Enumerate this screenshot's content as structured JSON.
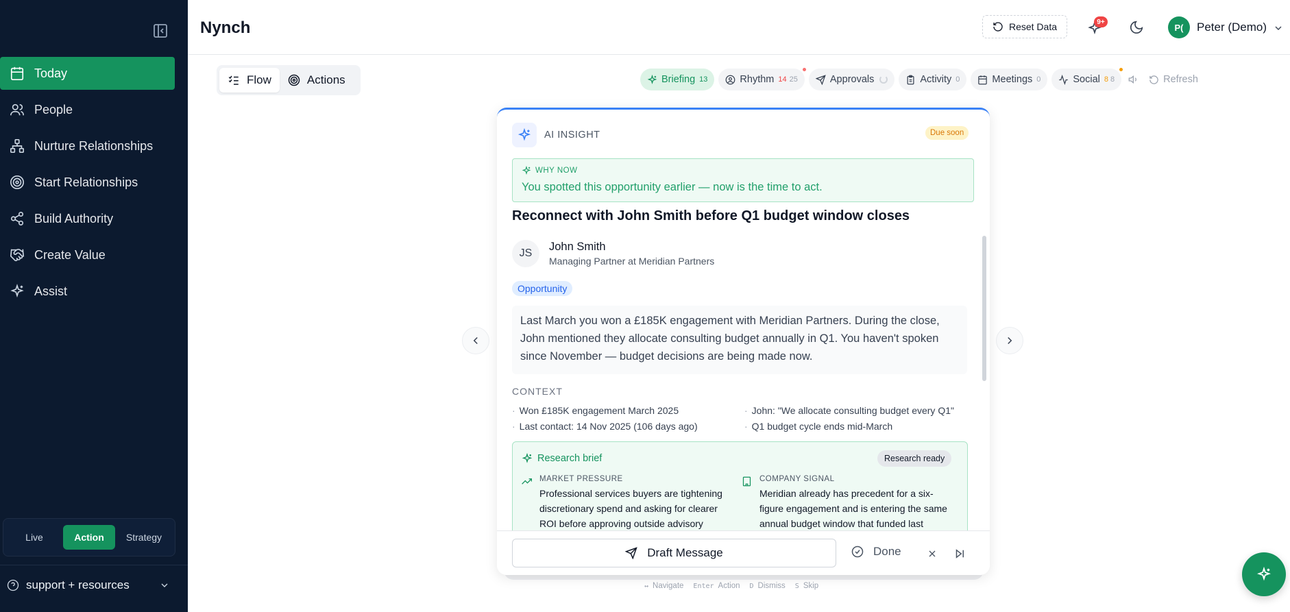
{
  "app": {
    "title": "Nynch"
  },
  "sidebar": {
    "items": [
      {
        "label": "Today",
        "icon": "calendar-icon",
        "active": true
      },
      {
        "label": "People",
        "icon": "people-icon"
      },
      {
        "label": "Nurture Relationships",
        "icon": "hierarchy-icon"
      },
      {
        "label": "Start Relationships",
        "icon": "target-icon"
      },
      {
        "label": "Build Authority",
        "icon": "share-icon"
      },
      {
        "label": "Create Value",
        "icon": "handshake-icon"
      },
      {
        "label": "Assist",
        "icon": "sparkle-icon"
      }
    ],
    "modes": [
      "Live",
      "Action",
      "Strategy"
    ],
    "active_mode": "Action",
    "support_label": "support + resources"
  },
  "header": {
    "reset_label": "Reset Data",
    "notifications_badge": "9+",
    "user_initials": "P(",
    "user_name": "Peter (Demo)"
  },
  "view_toggle": {
    "flow": "Flow",
    "actions": "Actions",
    "active": "Flow"
  },
  "tabs": [
    {
      "label": "Briefing",
      "count": "13",
      "active": true
    },
    {
      "label": "Rhythm",
      "count_a": "14",
      "count_b": "25"
    },
    {
      "label": "Approvals"
    },
    {
      "label": "Activity",
      "count": "0"
    },
    {
      "label": "Meetings",
      "count": "0"
    },
    {
      "label": "Social",
      "count_a": "8",
      "count_b": "8"
    }
  ],
  "refresh_label": "Refresh",
  "card": {
    "insight_label": "AI INSIGHT",
    "due_badge": "Due soon",
    "why_now_label": "WHY NOW",
    "why_now_text": "You spotted this opportunity earlier — now is the time to act.",
    "title": "Reconnect with John Smith before Q1 budget window closes",
    "person": {
      "initials": "JS",
      "name": "John Smith",
      "role": "Managing Partner at Meridian Partners"
    },
    "tag": "Opportunity",
    "summary": "Last March you won a £185K engagement with Meridian Partners. During the close, John mentioned they allocate consulting budget annually in Q1. You haven't spoken since November — budget decisions are being made now.",
    "context_label": "CONTEXT",
    "context": [
      "Won £185K engagement March 2025",
      "John: \"We allocate consulting budget every Q1\"",
      "Last contact: 14 Nov 2025 (106 days ago)",
      "Q1 budget cycle ends mid-March"
    ],
    "research": {
      "title": "Research brief",
      "badge": "Research ready",
      "signals": [
        {
          "label": "MARKET PRESSURE",
          "icon": "trend-up-icon",
          "text": "Professional services buyers are tightening discretionary spend and asking for clearer ROI before approving outside advisory"
        },
        {
          "label": "COMPANY SIGNAL",
          "icon": "building-icon",
          "text": "Meridian already has precedent for a six-figure engagement and is entering the same annual budget window that funded last"
        }
      ]
    },
    "draft_label": "Draft Message",
    "done_label": "Done"
  },
  "hints": [
    {
      "key": "↔",
      "label": "Navigate"
    },
    {
      "key": "Enter",
      "label": "Action"
    },
    {
      "key": "D",
      "label": "Dismiss"
    },
    {
      "key": "S",
      "label": "Skip"
    }
  ]
}
